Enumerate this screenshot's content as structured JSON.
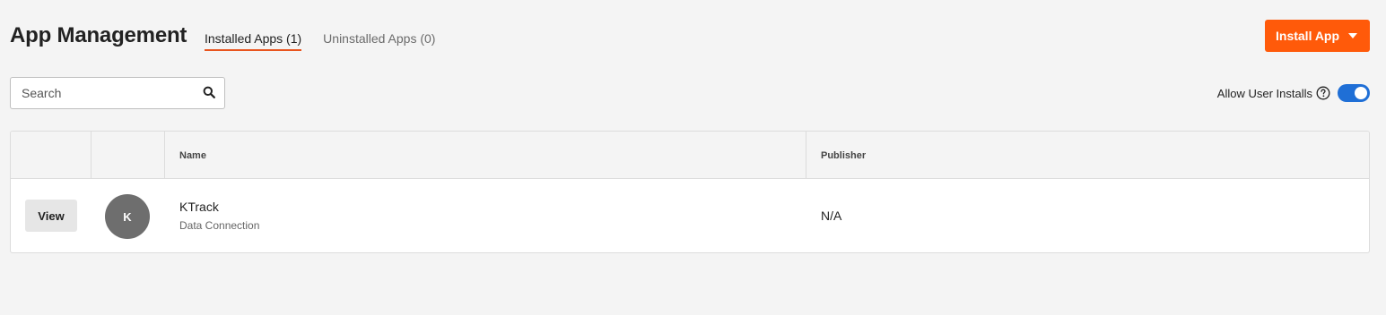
{
  "header": {
    "title": "App Management",
    "tabs": [
      {
        "label": "Installed Apps (1)",
        "active": true
      },
      {
        "label": "Uninstalled Apps (0)",
        "active": false
      }
    ],
    "install_button": {
      "label": "Install App",
      "icon": "caret-down-icon"
    }
  },
  "toolbar": {
    "search": {
      "placeholder": "Search",
      "value": "",
      "icon": "search-icon"
    },
    "allow_user_installs": {
      "label": "Allow User Installs",
      "help_icon": "help-icon",
      "enabled": true
    }
  },
  "table": {
    "columns": [
      "",
      "",
      "Name",
      "Publisher"
    ],
    "rows": [
      {
        "action_label": "View",
        "avatar_letter": "K",
        "name": "KTrack",
        "type": "Data Connection",
        "publisher": "N/A"
      }
    ]
  },
  "colors": {
    "accent": "#ff5a0a",
    "tab_underline": "#e8541e",
    "toggle_on": "#1f6fd6",
    "avatar_bg": "#6e6e6e",
    "page_bg": "#f4f4f4"
  }
}
